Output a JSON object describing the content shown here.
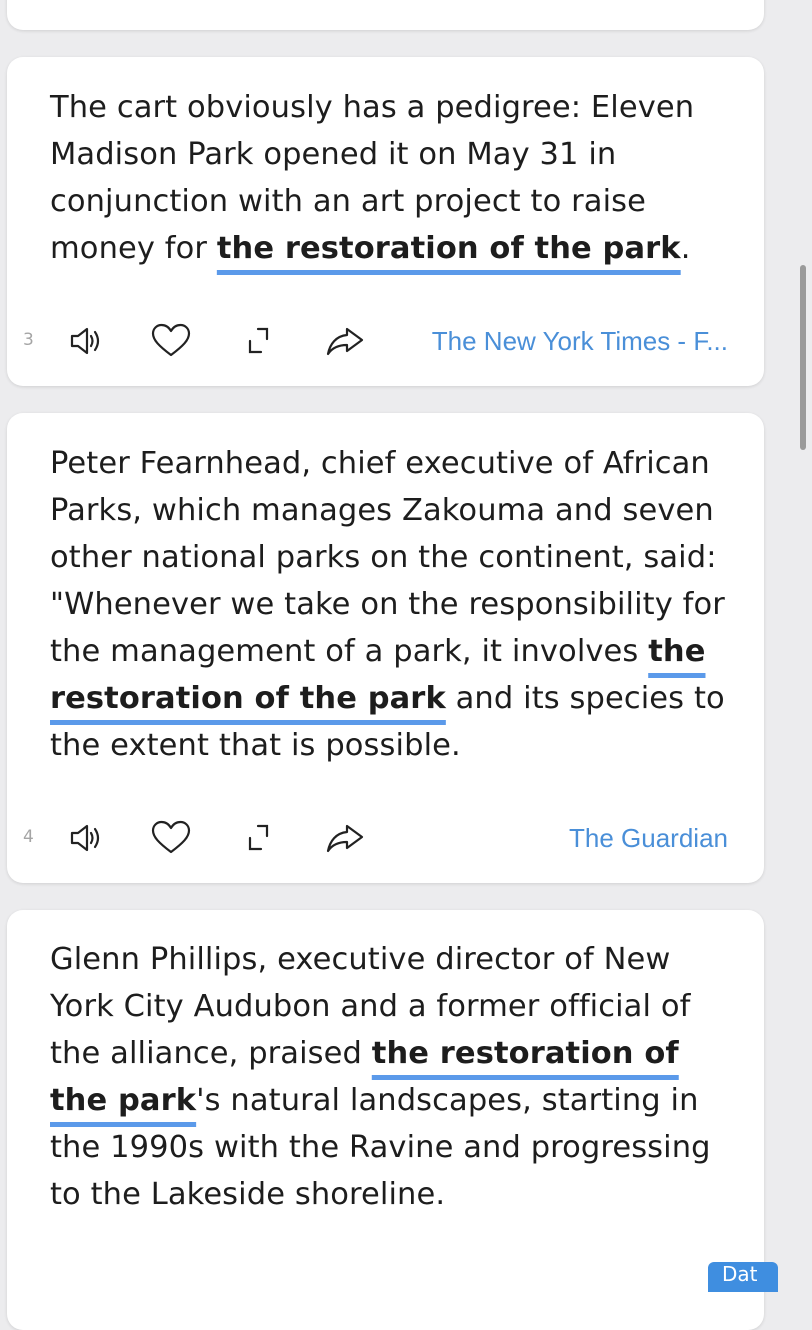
{
  "cards": [
    {
      "number": "3",
      "text_before": "The cart obviously has a pedigree: Eleven Madison Park opened it on May 31 in conjunction with an art project to raise money for ",
      "highlight": "the restoration of the park",
      "text_after": ".",
      "source": "The New York Times - F..."
    },
    {
      "number": "4",
      "text_before": "Peter Fearnhead, chief executive of African Parks, which manages Zakouma and seven other national parks on the continent, said: \"Whenever we take on the responsibility for the management of a park, it involves ",
      "highlight": "the restoration of the park",
      "text_after": " and its species to the extent that is possible.",
      "source": "The Guardian"
    },
    {
      "text_before": "Glenn Phillips, executive director of New York City Audubon and a former official of the alliance, praised ",
      "highlight": "the restoration of the park",
      "text_after": "'s natural landscapes, starting in the 1990s with the Ravine and progressing to the Lakeside shoreline."
    }
  ],
  "bottom_button": {
    "label": "Dat"
  },
  "colors": {
    "highlight_underline": "#5b9aea",
    "source_link": "#4a8fd8",
    "background": "#ececee"
  },
  "icons": [
    "speaker-icon",
    "heart-icon",
    "expand-icon",
    "share-icon"
  ]
}
